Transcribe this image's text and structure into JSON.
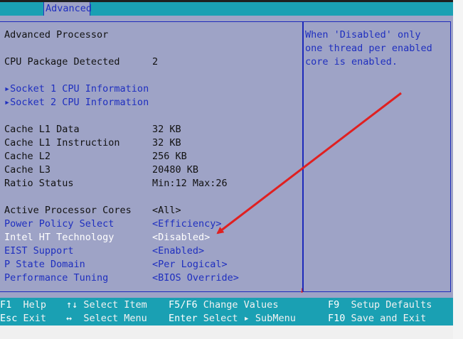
{
  "header": {
    "active_tab": "Advanced"
  },
  "section_title": "Advanced Processor",
  "info": [
    {
      "label": "CPU Package Detected",
      "value": "2"
    }
  ],
  "submenus": [
    {
      "label": "▸Socket 1 CPU Information"
    },
    {
      "label": "▸Socket 2 CPU Information"
    }
  ],
  "cache": [
    {
      "label": "Cache L1 Data",
      "value": "32 KB"
    },
    {
      "label": "Cache L1 Instruction",
      "value": "32 KB"
    },
    {
      "label": "Cache L2",
      "value": "256 KB"
    },
    {
      "label": "Cache L3",
      "value": "20480 KB"
    },
    {
      "label": "Ratio Status",
      "value": "Min:12 Max:26"
    }
  ],
  "settings": [
    {
      "label": "Active Processor Cores",
      "value": "<All>"
    },
    {
      "label": "Power Policy Select",
      "value": "<Efficiency>"
    },
    {
      "label": "Intel HT Technology",
      "value": "<Disabled>"
    },
    {
      "label": "EIST Support",
      "value": "<Enabled>"
    },
    {
      "label": "P State Domain",
      "value": "<Per Logical>"
    },
    {
      "label": "Performance Tuning",
      "value": "<BIOS Override>"
    }
  ],
  "help_text": [
    "When 'Disabled' only",
    "one thread per enabled",
    "core is enabled."
  ],
  "footer": {
    "row1": [
      {
        "key": "F1",
        "action": "Help"
      },
      {
        "key": "↑↓",
        "action": "Select Item"
      },
      {
        "key": "F5/F6",
        "action": "Change Values"
      },
      {
        "key": "F9",
        "action": "Setup Defaults"
      }
    ],
    "row2": [
      {
        "key": "Esc",
        "action": "Exit"
      },
      {
        "key": "↔",
        "action": "Select Menu"
      },
      {
        "key": "Enter",
        "action": "Select ▸ SubMenu"
      },
      {
        "key": "F10",
        "action": "Save and Exit"
      }
    ]
  },
  "colors": {
    "panel": "#9ea3c6",
    "bar": "#1aa0b3",
    "border": "#1d2aba",
    "arrow": "#e02020"
  }
}
